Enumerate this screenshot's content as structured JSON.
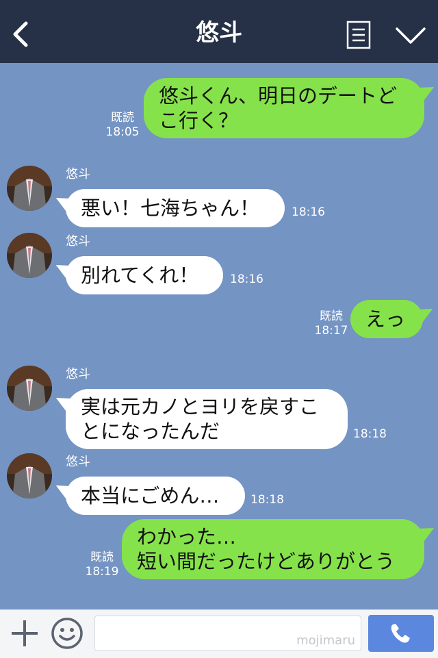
{
  "header": {
    "title": "悠斗"
  },
  "messages": [
    {
      "side": "right",
      "text": "悠斗くん、明日のデートど\nこ行く？",
      "read": "既読",
      "time": "18:05"
    },
    {
      "side": "left",
      "name": "悠斗",
      "text": "悪い！七海ちゃん！",
      "time": "18:16"
    },
    {
      "side": "left",
      "name": "悠斗",
      "text": "別れてくれ！",
      "time": "18:16"
    },
    {
      "side": "right",
      "text": "えっ",
      "read": "既読",
      "time": "18:17"
    },
    {
      "side": "left",
      "name": "悠斗",
      "text": "実は元カノとヨリを戻すこ\nとになったんだ",
      "time": "18:18"
    },
    {
      "side": "left",
      "name": "悠斗",
      "text": "本当にごめん…",
      "time": "18:18"
    },
    {
      "side": "right",
      "text": "わかった…\n短い間だったけどありがとう",
      "read": "既読",
      "time": "18:19"
    }
  ],
  "footer": {
    "watermark": "mojimaru"
  },
  "colors": {
    "header": "#263046",
    "background": "#7494c3",
    "green_bubble": "#86e24a",
    "call_button": "#5b88de"
  },
  "icons": [
    "back-arrow-icon",
    "menu-list-icon",
    "chevron-down-icon",
    "plus-icon",
    "smile-icon",
    "phone-icon"
  ]
}
